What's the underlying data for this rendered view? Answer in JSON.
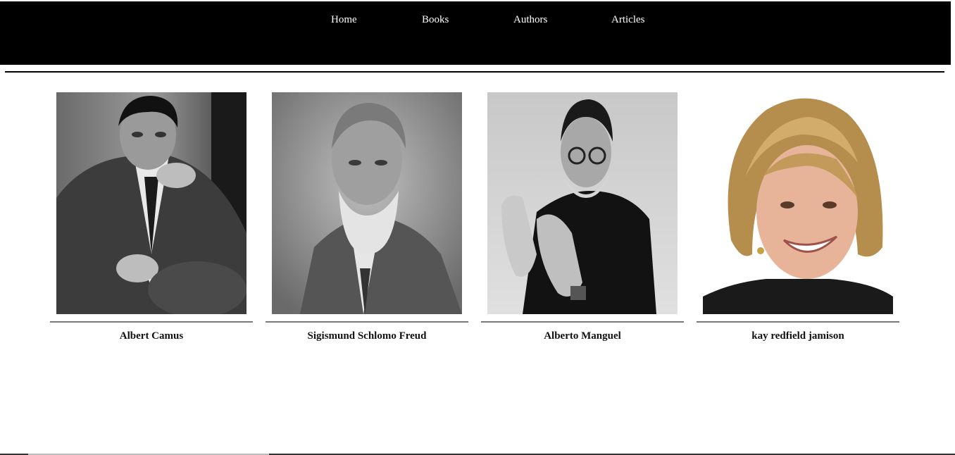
{
  "nav": {
    "items": [
      {
        "label": "Home"
      },
      {
        "label": "Books"
      },
      {
        "label": "Authors"
      },
      {
        "label": "Articles"
      }
    ]
  },
  "authors": [
    {
      "name": "Albert Camus"
    },
    {
      "name": "Sigismund Schlomo Freud"
    },
    {
      "name": "Alberto Manguel"
    },
    {
      "name": "kay redfield jamison"
    }
  ],
  "colors": {
    "navbar_background": "#000000",
    "nav_text": "#ffffff",
    "page_background": "#ffffff",
    "card_rule": "#7a7a7a"
  }
}
